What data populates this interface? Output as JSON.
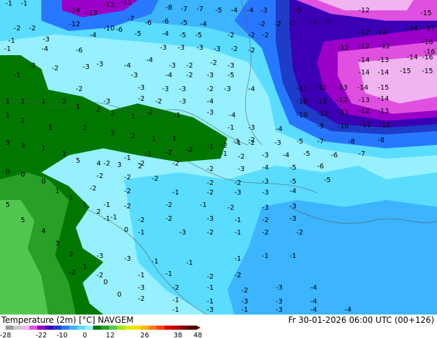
{
  "map": {
    "title_left": "Temperature (2m) [°C] NAVGEM",
    "title_right": "Fr 30-01-2026 06:00 UTC (00+126)",
    "colorbar": {
      "ticks": [
        "-28",
        "-22",
        "-10",
        "0",
        "12",
        "26",
        "38",
        "48"
      ],
      "colors": [
        "#9a9a9a",
        "#c9c9c9",
        "#f0b4f0",
        "#e050e0",
        "#9a00c8",
        "#3c00b4",
        "#1e3cc8",
        "#2878ff",
        "#3cb4ff",
        "#5adcff",
        "#96f0ff",
        "#007800",
        "#28a028",
        "#50c850",
        "#a0e600",
        "#dcf000",
        "#ffdc00",
        "#ffb400",
        "#ff7800",
        "#ff3c00",
        "#dc0000",
        "#b40000",
        "#800000",
        "#500000"
      ]
    },
    "point_values": [
      {
        "t": "-1"
      },
      {
        "t": "-1"
      },
      {
        "t": "-14"
      },
      {
        "t": "-13"
      },
      {
        "t": "-12"
      },
      {
        "t": "-11"
      },
      {
        "t": "-8"
      },
      {
        "t": "-7"
      },
      {
        "t": "-7"
      },
      {
        "t": "-5"
      },
      {
        "t": "-4"
      },
      {
        "t": "-4"
      },
      {
        "t": "-3"
      },
      {
        "t": "-5"
      },
      {
        "t": "-12"
      },
      {
        "t": "-15"
      },
      {
        "t": "-2"
      },
      {
        "t": "-2"
      },
      {
        "t": "-12"
      },
      {
        "t": "-10"
      },
      {
        "t": "-7"
      },
      {
        "t": "-6"
      },
      {
        "t": "-6"
      },
      {
        "t": "-5"
      },
      {
        "t": "-4"
      },
      {
        "t": "-2"
      },
      {
        "t": "-2"
      },
      {
        "t": "-3"
      },
      {
        "t": "-4"
      },
      {
        "t": "-5"
      },
      {
        "t": "-14"
      },
      {
        "t": "-17"
      },
      {
        "t": "-1"
      },
      {
        "t": "-3"
      },
      {
        "t": "-4"
      },
      {
        "t": "-6"
      },
      {
        "t": "-5"
      },
      {
        "t": "-4"
      },
      {
        "t": "-5"
      },
      {
        "t": "-5"
      },
      {
        "t": "-2"
      },
      {
        "t": "-2"
      },
      {
        "t": "-2"
      },
      {
        "t": "-12"
      },
      {
        "t": "-12"
      },
      {
        "t": "-16"
      },
      {
        "t": "-1"
      },
      {
        "t": "-4"
      },
      {
        "t": "-6"
      },
      {
        "t": "-3"
      },
      {
        "t": "-3"
      },
      {
        "t": "-3"
      },
      {
        "t": "-3"
      },
      {
        "t": "-2"
      },
      {
        "t": "-2"
      },
      {
        "t": "-12"
      },
      {
        "t": "-12"
      },
      {
        "t": "-12"
      },
      {
        "t": "-16"
      },
      {
        "t": "-2"
      },
      {
        "t": "-3"
      },
      {
        "t": "-4"
      },
      {
        "t": "-4"
      },
      {
        "t": "-3"
      },
      {
        "t": "-2"
      },
      {
        "t": "-2"
      },
      {
        "t": "-3"
      },
      {
        "t": "-14"
      },
      {
        "t": "-13"
      },
      {
        "t": "-14"
      },
      {
        "t": "-16"
      },
      {
        "t": "-1"
      },
      {
        "t": "-2"
      },
      {
        "t": "-3"
      },
      {
        "t": "-3"
      },
      {
        "t": "-4"
      },
      {
        "t": "-2"
      },
      {
        "t": "-3"
      },
      {
        "t": "-5"
      },
      {
        "t": "-14"
      },
      {
        "t": "-14"
      },
      {
        "t": "-15"
      },
      {
        "t": "-15"
      },
      {
        "t": "-2"
      },
      {
        "t": "-3"
      },
      {
        "t": "-3"
      },
      {
        "t": "-3"
      },
      {
        "t": "-2"
      },
      {
        "t": "-3"
      },
      {
        "t": "-4"
      },
      {
        "t": "-11"
      },
      {
        "t": "-12"
      },
      {
        "t": "-13"
      },
      {
        "t": "-14"
      },
      {
        "t": "-15"
      },
      {
        "t": "-3"
      },
      {
        "t": "-2"
      },
      {
        "t": "-2"
      },
      {
        "t": "-3"
      },
      {
        "t": "-4"
      },
      {
        "t": "-10"
      },
      {
        "t": "-11"
      },
      {
        "t": "-12"
      },
      {
        "t": "-13"
      },
      {
        "t": "-14"
      },
      {
        "t": "-2"
      },
      {
        "t": "-1"
      },
      {
        "t": "-3"
      },
      {
        "t": "-4"
      },
      {
        "t": "-10"
      },
      {
        "t": "-11"
      },
      {
        "t": "-11"
      },
      {
        "t": "-12"
      },
      {
        "t": "-13"
      },
      {
        "t": "-1"
      },
      {
        "t": "-3"
      },
      {
        "t": "-4"
      },
      {
        "t": "-9"
      },
      {
        "t": "-10"
      },
      {
        "t": "-11"
      },
      {
        "t": "-11"
      },
      {
        "t": "-1"
      },
      {
        "t": "-2"
      },
      {
        "t": "-3"
      },
      {
        "t": "-5"
      },
      {
        "t": "-7"
      },
      {
        "t": "-8"
      },
      {
        "t": "-8"
      },
      {
        "t": "-1"
      },
      {
        "t": "-2"
      },
      {
        "t": "-3"
      },
      {
        "t": "-4"
      },
      {
        "t": "-5"
      },
      {
        "t": "-6"
      },
      {
        "t": "-7"
      },
      {
        "t": "-2"
      },
      {
        "t": "-2"
      },
      {
        "t": "-2"
      },
      {
        "t": "-2"
      },
      {
        "t": "-3"
      },
      {
        "t": "-4"
      },
      {
        "t": "-5"
      },
      {
        "t": "-6"
      },
      {
        "t": "-2"
      },
      {
        "t": "-2"
      },
      {
        "t": "-2"
      },
      {
        "t": "-2"
      },
      {
        "t": "-2"
      },
      {
        "t": "-3"
      },
      {
        "t": "-5"
      },
      {
        "t": "-5"
      },
      {
        "t": "-2"
      },
      {
        "t": "-2"
      },
      {
        "t": "-1"
      },
      {
        "t": "-2"
      },
      {
        "t": "-3"
      },
      {
        "t": "-3"
      },
      {
        "t": "-4"
      },
      {
        "t": "-1"
      },
      {
        "t": "-2"
      },
      {
        "t": "-2"
      },
      {
        "t": "-1"
      },
      {
        "t": "-2"
      },
      {
        "t": "-3"
      },
      {
        "t": "-3"
      },
      {
        "t": "-1"
      },
      {
        "t": "-2"
      },
      {
        "t": "-2"
      },
      {
        "t": "-3"
      },
      {
        "t": "-1"
      },
      {
        "t": "-2"
      },
      {
        "t": "-3"
      },
      {
        "t": "0"
      },
      {
        "t": "-1"
      },
      {
        "t": "-3"
      },
      {
        "t": "-2"
      },
      {
        "t": "-1"
      },
      {
        "t": "-2"
      },
      {
        "t": "-2"
      },
      {
        "t": "-3"
      },
      {
        "t": "-3"
      },
      {
        "t": "-1"
      },
      {
        "t": "-1"
      },
      {
        "t": "-1"
      },
      {
        "t": "-1"
      },
      {
        "t": "-1"
      },
      {
        "t": "-2"
      },
      {
        "t": "-2"
      },
      {
        "t": "-1"
      },
      {
        "t": "-1"
      },
      {
        "t": "-2"
      },
      {
        "t": "-2"
      },
      {
        "t": "-3"
      },
      {
        "t": "-2"
      },
      {
        "t": "-1"
      },
      {
        "t": "-2"
      },
      {
        "t": "-3"
      },
      {
        "t": "-4"
      },
      {
        "t": "-2"
      },
      {
        "t": "-1"
      },
      {
        "t": "-1"
      },
      {
        "t": "-3"
      },
      {
        "t": "-3"
      },
      {
        "t": "-4"
      },
      {
        "t": "-1"
      },
      {
        "t": "-3"
      },
      {
        "t": "-1"
      },
      {
        "t": "-3"
      },
      {
        "t": "-4"
      },
      {
        "t": "-4"
      },
      {
        "t": "1"
      },
      {
        "t": "1"
      },
      {
        "t": "1"
      },
      {
        "t": "2"
      },
      {
        "t": "1"
      },
      {
        "t": "2"
      },
      {
        "t": "2"
      },
      {
        "t": "1"
      },
      {
        "t": "1"
      },
      {
        "t": "2"
      },
      {
        "t": "1"
      },
      {
        "t": "2"
      },
      {
        "t": "3"
      },
      {
        "t": "2"
      },
      {
        "t": "1"
      },
      {
        "t": "1"
      },
      {
        "t": "3"
      },
      {
        "t": "3"
      },
      {
        "t": "1"
      },
      {
        "t": "1"
      },
      {
        "t": "5"
      },
      {
        "t": "4"
      },
      {
        "t": "3"
      },
      {
        "t": "2"
      },
      {
        "t": "5"
      },
      {
        "t": "5"
      },
      {
        "t": "4"
      },
      {
        "t": "3"
      },
      {
        "t": "2"
      },
      {
        "t": "1"
      },
      {
        "t": "0"
      },
      {
        "t": "0"
      },
      {
        "t": "0"
      },
      {
        "t": "0"
      },
      {
        "t": "0"
      },
      {
        "t": "1"
      },
      {
        "t": "1"
      },
      {
        "t": "1"
      },
      {
        "t": "2"
      },
      {
        "t": "-1"
      },
      {
        "t": "-1"
      },
      {
        "t": "-1"
      },
      {
        "t": "-2"
      },
      {
        "t": "-2"
      },
      {
        "t": "-1"
      },
      {
        "t": "-2"
      },
      {
        "t": "-1"
      },
      {
        "t": "-2"
      }
    ]
  }
}
